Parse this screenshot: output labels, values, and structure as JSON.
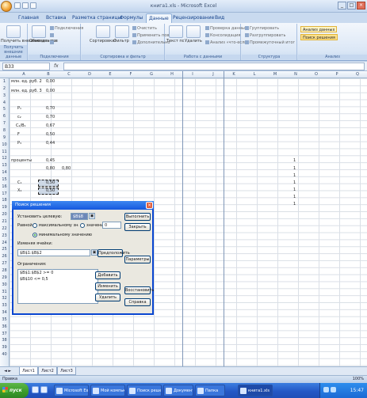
{
  "window": {
    "title": "книга1.xls - Microsoft Excel"
  },
  "ribbon": {
    "tabs": [
      "Главная",
      "Вставка",
      "Разметка страницы",
      "Формулы",
      "Данные",
      "Рецензирование",
      "Вид"
    ],
    "active_tab": "Данные",
    "groups": [
      "Получить внешние данные",
      "Подключения",
      "Сортировка и фильтр",
      "Работа с данными",
      "Структура",
      "Анализ"
    ],
    "get_data_label": "Получить внешние данные",
    "refresh_label": "Обновить все",
    "connections_label": "Подключения",
    "sort_label": "Сортировка",
    "filter_label": "Фильтр",
    "clear_label": "Очистить",
    "reapply_label": "Применить повторно",
    "advanced_label": "Дополнительно",
    "text_to_columns_label": "Текст по столбцам",
    "remove_duplicates_label": "Удалить дубликаты",
    "validation_label": "Проверка данных",
    "consolidate_label": "Консолидация",
    "whatif_label": "Анализ «что-если»",
    "group_label": "Группировать",
    "ungroup_label": "Разгруппировать",
    "subtotal_label": "Промежуточный итог",
    "analysis_label": "Анализ данных",
    "solver_label": "Поиск решения"
  },
  "formula_bar": {
    "name_box": "B33",
    "fx": "fx",
    "content": ""
  },
  "grid": {
    "columns": [
      "A",
      "B",
      "C",
      "D",
      "E",
      "F",
      "G",
      "H",
      "I",
      "J",
      "K",
      "L",
      "M",
      "N",
      "O",
      "P",
      "Q",
      "R"
    ],
    "rows": [
      "1",
      "2",
      "3",
      "4",
      "5",
      "6",
      "7",
      "8",
      "9",
      "10",
      "11",
      "12",
      "13",
      "14",
      "15",
      "16",
      "17",
      "18",
      "19",
      "20",
      "21",
      "22",
      "23",
      "24",
      "25",
      "26",
      "27",
      "28",
      "29",
      "30",
      "31",
      "32",
      "33",
      "34",
      "35",
      "36",
      "37",
      "38",
      "39",
      "40"
    ],
    "a1": "млн. ед. руб. 2",
    "b1": "0,00",
    "a2": "млн. ед. руб. 3",
    "b2": "0,00",
    "a4": "P₁",
    "b4": "0,70",
    "a5": "c₂",
    "b5": "0,70",
    "a6": "C₂/B₁",
    "b6": "0,67",
    "a7": "F",
    "b7": "0,50",
    "a8": "P₃",
    "b8": "0,44",
    "a10": "проценты",
    "b10": "0,45",
    "b11": "0,80",
    "c11": "0,80",
    "a13": "C₁",
    "b13": "0,50",
    "a14": "X₁",
    "b14": "0,50",
    "right_vals": [
      "1",
      "1",
      "1",
      "1",
      "1",
      "1",
      "1"
    ]
  },
  "sheets": {
    "tabs": [
      "Лист1",
      "Лист2",
      "Лист3"
    ],
    "active": "Лист1"
  },
  "status": {
    "text": "Правка",
    "zoom": "100%"
  },
  "solver": {
    "title": "Поиск решения",
    "target_label": "Установить целевую:",
    "target_value": "$B$8",
    "equal_label": "Равной:",
    "max_label": "максимальному значению",
    "value_label": "значению:",
    "value_input": "0",
    "min_label": "минимальному значению",
    "changing_label": "Изменяя ячейки:",
    "changing_value": "$B$1:$B$2",
    "guess_label": "Предположить",
    "constraints_label": "Ограничения:",
    "constraints": [
      "$B$1:$B$2 >= 0",
      "$B$10 <= 0,5"
    ],
    "add_label": "Добавить",
    "change_label": "Изменить",
    "delete_label": "Удалить",
    "run_label": "Выполнить",
    "close_label": "Закрыть",
    "options_label": "Параметры",
    "reset_label": "Восстановить",
    "help_label": "Справка",
    "close_x": "×"
  },
  "taskbar": {
    "start": "пуск",
    "tasks": [
      "Microsoft Excel",
      "Мой компьютер",
      "Поиск решения",
      "Документ",
      "Папка",
      "книга1.xls"
    ],
    "clock": "15:47"
  }
}
